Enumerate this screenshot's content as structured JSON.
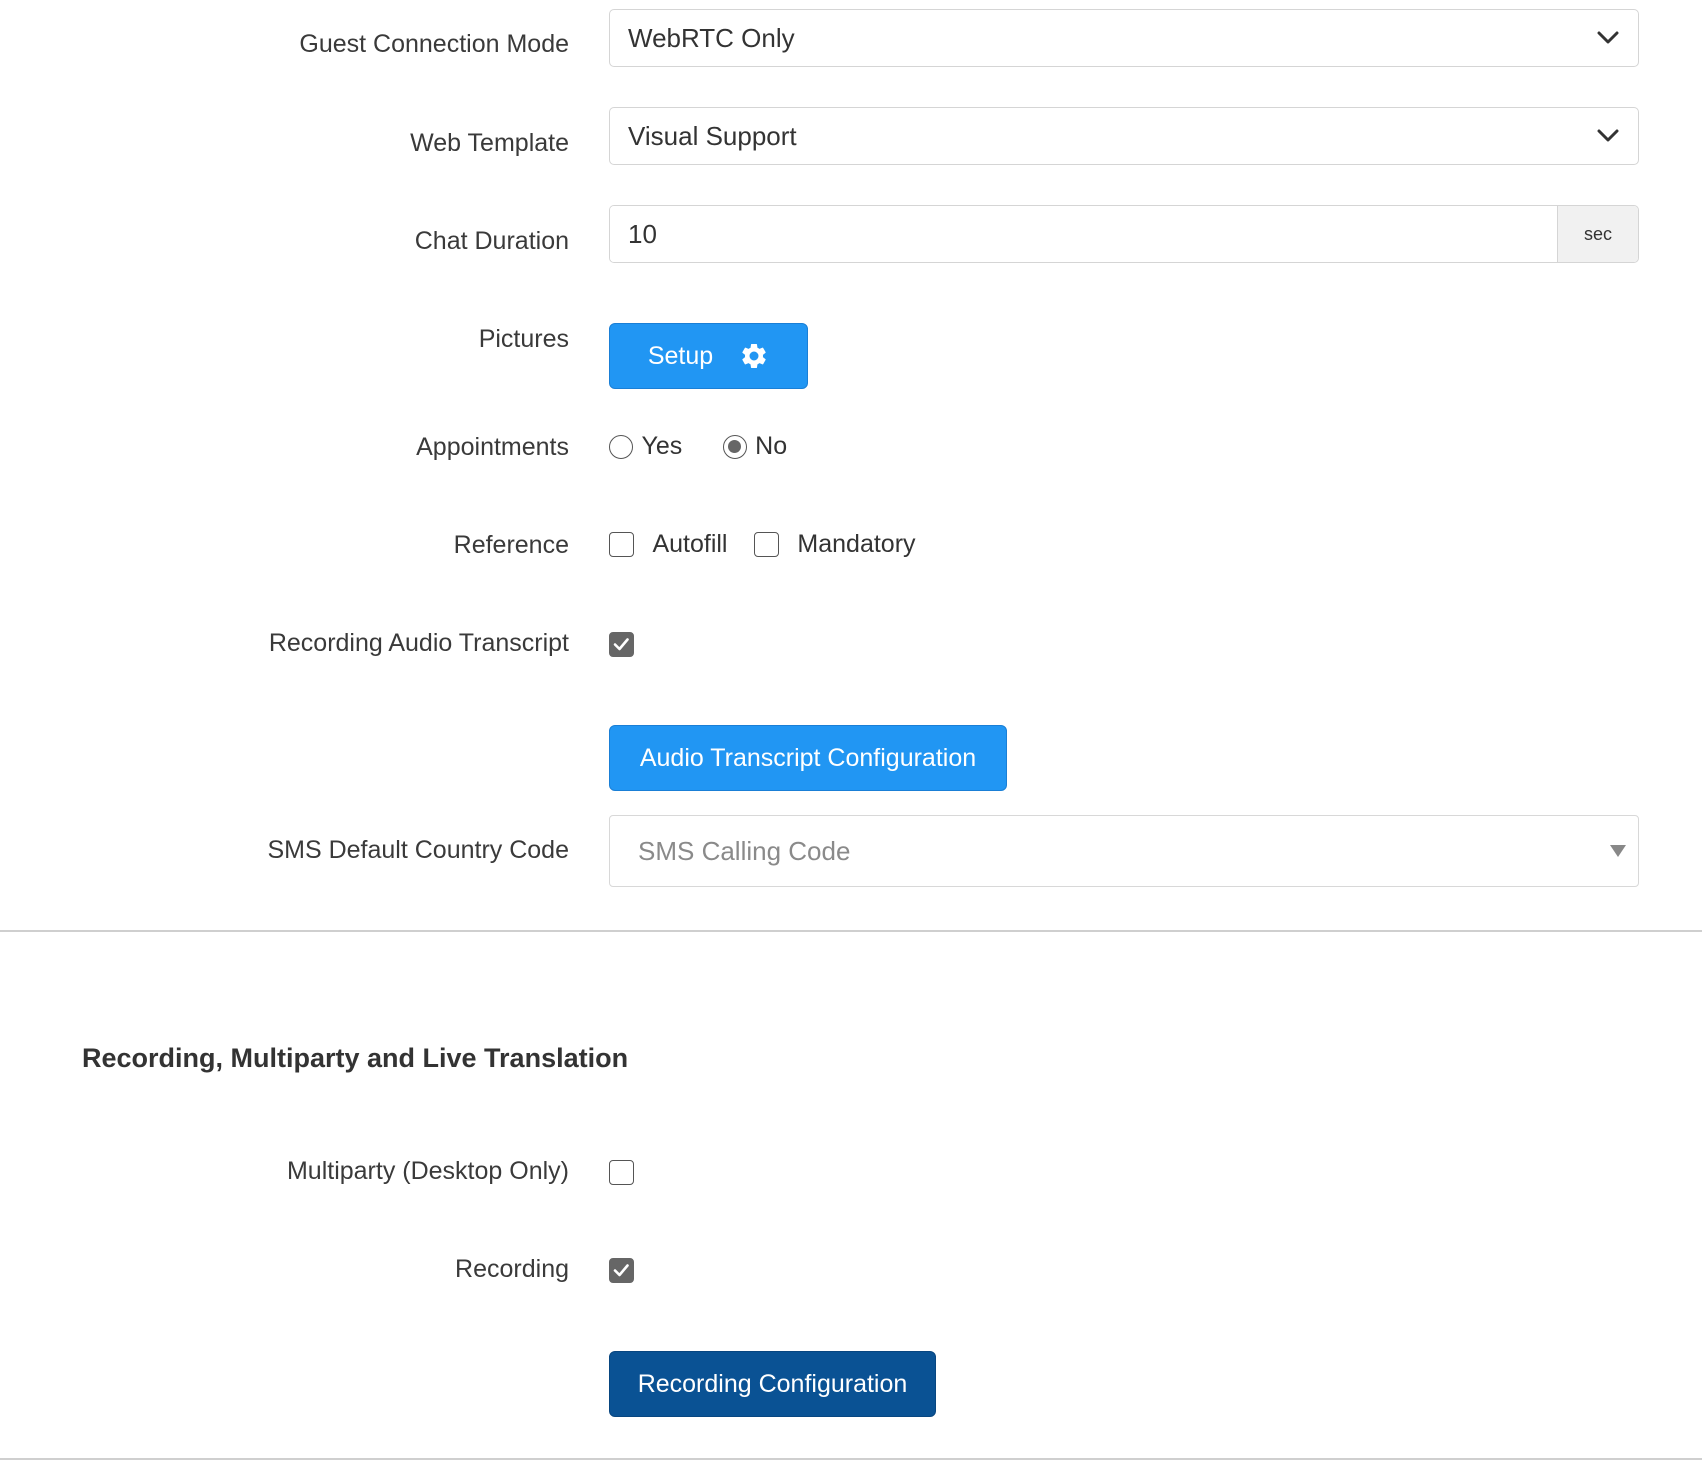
{
  "guest_connection_mode": {
    "label": "Guest Connection Mode",
    "value": "WebRTC Only"
  },
  "web_template": {
    "label": "Web Template",
    "value": "Visual Support"
  },
  "chat_duration": {
    "label": "Chat Duration",
    "value": "10",
    "unit": "sec"
  },
  "pictures": {
    "label": "Pictures",
    "button": "Setup",
    "icon": "gear-icon"
  },
  "appointments": {
    "label": "Appointments",
    "options": [
      "Yes",
      "No"
    ],
    "selected": "No"
  },
  "reference": {
    "label": "Reference",
    "options": [
      "Autofill",
      "Mandatory"
    ],
    "checked": []
  },
  "recording_audio_transcript": {
    "label": "Recording Audio Transcript",
    "checked": true
  },
  "audio_transcript_config": {
    "button": "Audio Transcript Configuration"
  },
  "sms_default_country_code": {
    "label": "SMS Default Country Code",
    "placeholder": "SMS Calling Code"
  },
  "section2": {
    "title": "Recording, Multiparty and Live Translation"
  },
  "multiparty": {
    "label": "Multiparty (Desktop Only)",
    "checked": false
  },
  "recording": {
    "label": "Recording",
    "checked": true
  },
  "recording_config": {
    "button": "Recording Configuration"
  },
  "colors": {
    "primary": "#2196f3",
    "primary_dark": "#0a5294",
    "checkbox_checked": "#666666"
  }
}
